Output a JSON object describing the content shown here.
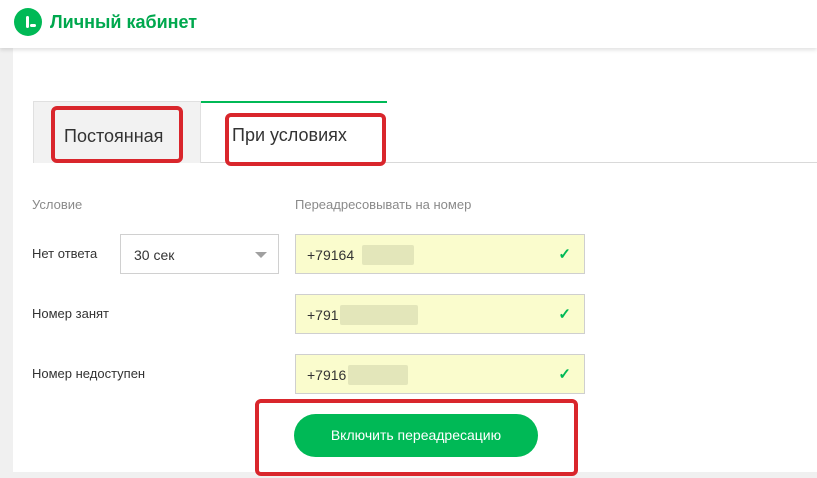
{
  "header": {
    "brand": "Личный кабинет"
  },
  "tabs": [
    {
      "label": "Постоянная",
      "active": false
    },
    {
      "label": "При условиях",
      "active": true
    }
  ],
  "columns": {
    "condition": "Условие",
    "forward_to": "Переадресовывать на номер"
  },
  "rows": [
    {
      "label": "Нет ответа",
      "delay": "30 сек",
      "phone": "+79164"
    },
    {
      "label": "Номер занят",
      "phone": "+791"
    },
    {
      "label": "Номер недоступен",
      "phone": "+7916"
    }
  ],
  "button": {
    "label": "Включить переадресацию"
  },
  "colors": {
    "accent": "#00b956",
    "highlight": "#d9262c",
    "field_bg": "#fafccd"
  }
}
